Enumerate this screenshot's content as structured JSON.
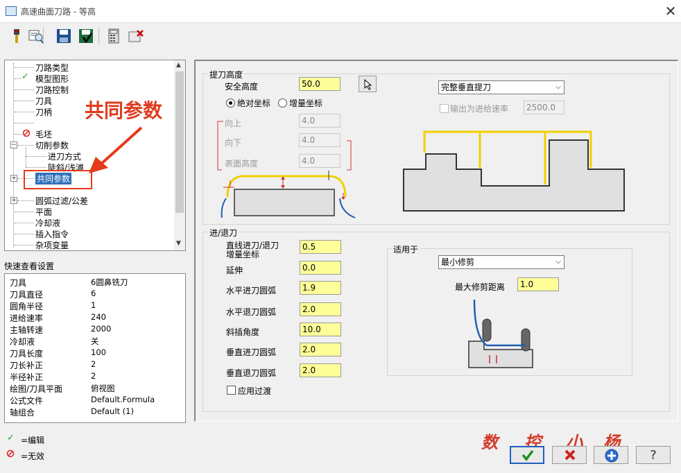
{
  "window": {
    "title": "高速曲面刀路 - 等高"
  },
  "toolbar": {
    "icons": [
      "tool-icon",
      "view-icon",
      "save-icon",
      "save-as-icon",
      "calculator-icon",
      "delete-icon"
    ]
  },
  "tree": {
    "items": [
      {
        "label": "刀路类型"
      },
      {
        "label": "模型图形"
      },
      {
        "label": "刀路控制"
      },
      {
        "label": "刀具"
      },
      {
        "label": "刀柄"
      },
      {
        "label": "毛坯"
      },
      {
        "label": "切削参数"
      },
      {
        "label": "进刀方式"
      },
      {
        "label": "陡斜/浅滩"
      },
      {
        "label": "共同参数"
      },
      {
        "label": "圆弧过滤/公差"
      },
      {
        "label": "平面"
      },
      {
        "label": "冷却液"
      },
      {
        "label": "插入指令"
      },
      {
        "label": "杂项变量"
      }
    ]
  },
  "annotation": {
    "text": "共同参数"
  },
  "quickview": {
    "title": "快速查看设置",
    "rows": [
      {
        "k": "刀具",
        "v": "6圆鼻铣刀"
      },
      {
        "k": "刀具直径",
        "v": "6"
      },
      {
        "k": "圆角半径",
        "v": "1"
      },
      {
        "k": "进给速率",
        "v": "240"
      },
      {
        "k": "主轴转速",
        "v": "2000"
      },
      {
        "k": "冷却液",
        "v": "关"
      },
      {
        "k": "刀具长度",
        "v": "100"
      },
      {
        "k": "刀长补正",
        "v": "2"
      },
      {
        "k": "半径补正",
        "v": "2"
      },
      {
        "k": "绘图/刀具平面",
        "v": "俯视图"
      },
      {
        "k": "公式文件",
        "v": "Default.Formula"
      },
      {
        "k": "轴组合",
        "v": "Default (1)"
      }
    ]
  },
  "legend": {
    "edit": "=编辑",
    "invalid": "=无效"
  },
  "retract": {
    "group_title": "提刀高度",
    "safe_height_label": "安全高度",
    "safe_height": "50.0",
    "absolute_label": "绝对坐标",
    "incremental_label": "增量坐标",
    "up_label": "向上",
    "up_value": "4.0",
    "down_label": "向下",
    "down_value": "4.0",
    "surface_label": "表面高度",
    "surface_value": "4.0",
    "mode_combo": "完整垂直提刀",
    "feed_label": "输出为进给速率",
    "feed_value": "2500.0"
  },
  "entry": {
    "group_title": "进/退刀",
    "line_label_1": "直线进刀/退刀",
    "line_label_2": "增量坐标",
    "line_value": "0.5",
    "extend_label": "延伸",
    "extend_value": "0.0",
    "h_entry_label": "水平进刀圆弧",
    "h_entry_value": "1.9",
    "h_exit_label": "水平退刀圆弧",
    "h_exit_value": "2.0",
    "ramp_label": "斜插角度",
    "ramp_value": "10.0",
    "v_entry_label": "垂直进刀圆弧",
    "v_entry_value": "2.0",
    "v_exit_label": "垂直退刀圆弧",
    "v_exit_value": "2.0",
    "transition_label": "应用过渡"
  },
  "applies": {
    "title": "适用于",
    "combo": "最小修剪",
    "max_trim_label": "最大修剪距离",
    "max_trim_value": "1.0"
  },
  "signature": {
    "chars": [
      "数",
      "控",
      "小",
      "杨"
    ]
  },
  "buttons": {
    "ok": "ok",
    "cancel": "cancel",
    "add": "add",
    "help": "?"
  }
}
